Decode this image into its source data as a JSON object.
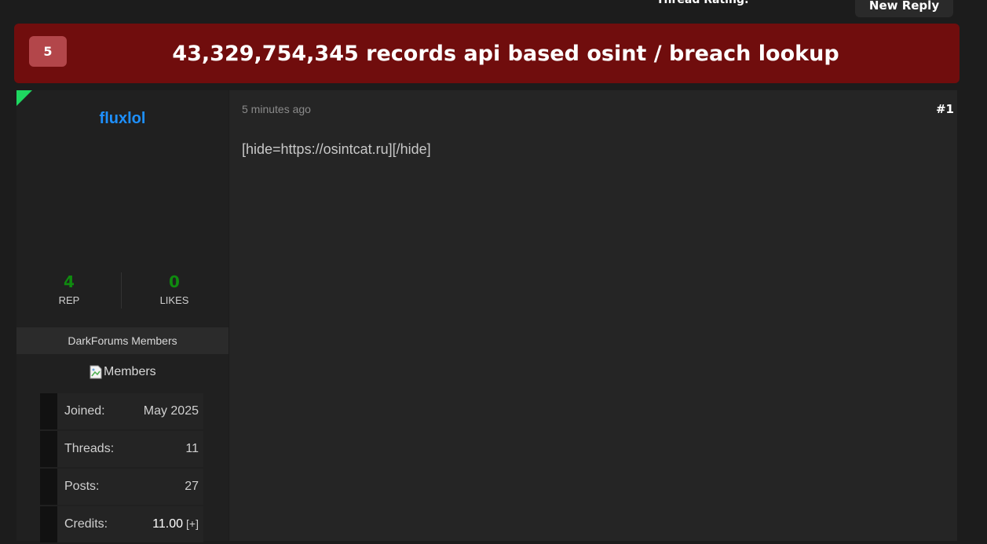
{
  "header": {
    "thread_rating_label": "Thread Rating:",
    "new_reply_label": "New Reply"
  },
  "thread": {
    "rating": "5",
    "title": "43,329,754,345 records api based osint / breach lookup"
  },
  "user": {
    "username": "fluxlol",
    "rep_value": "4",
    "rep_label": "REP",
    "likes_value": "0",
    "likes_label": "LIKES",
    "group": "DarkForums Members",
    "group_image_alt": "Members",
    "info": [
      {
        "key": "Joined:",
        "value": "May 2025"
      },
      {
        "key": "Threads:",
        "value": "11"
      },
      {
        "key": "Posts:",
        "value": "27"
      },
      {
        "key": "Credits:",
        "value": "11.00",
        "extra": "[+]"
      }
    ]
  },
  "post": {
    "time": "5 minutes ago",
    "number": "#1",
    "body": "[hide=https://osintcat.ru][/hide]"
  },
  "colors": {
    "title_bar": "#700d0d",
    "rating_badge": "#b3464a",
    "username": "#1e90ff",
    "stat_value": "#0f8a0f",
    "online": "#1ed760"
  }
}
